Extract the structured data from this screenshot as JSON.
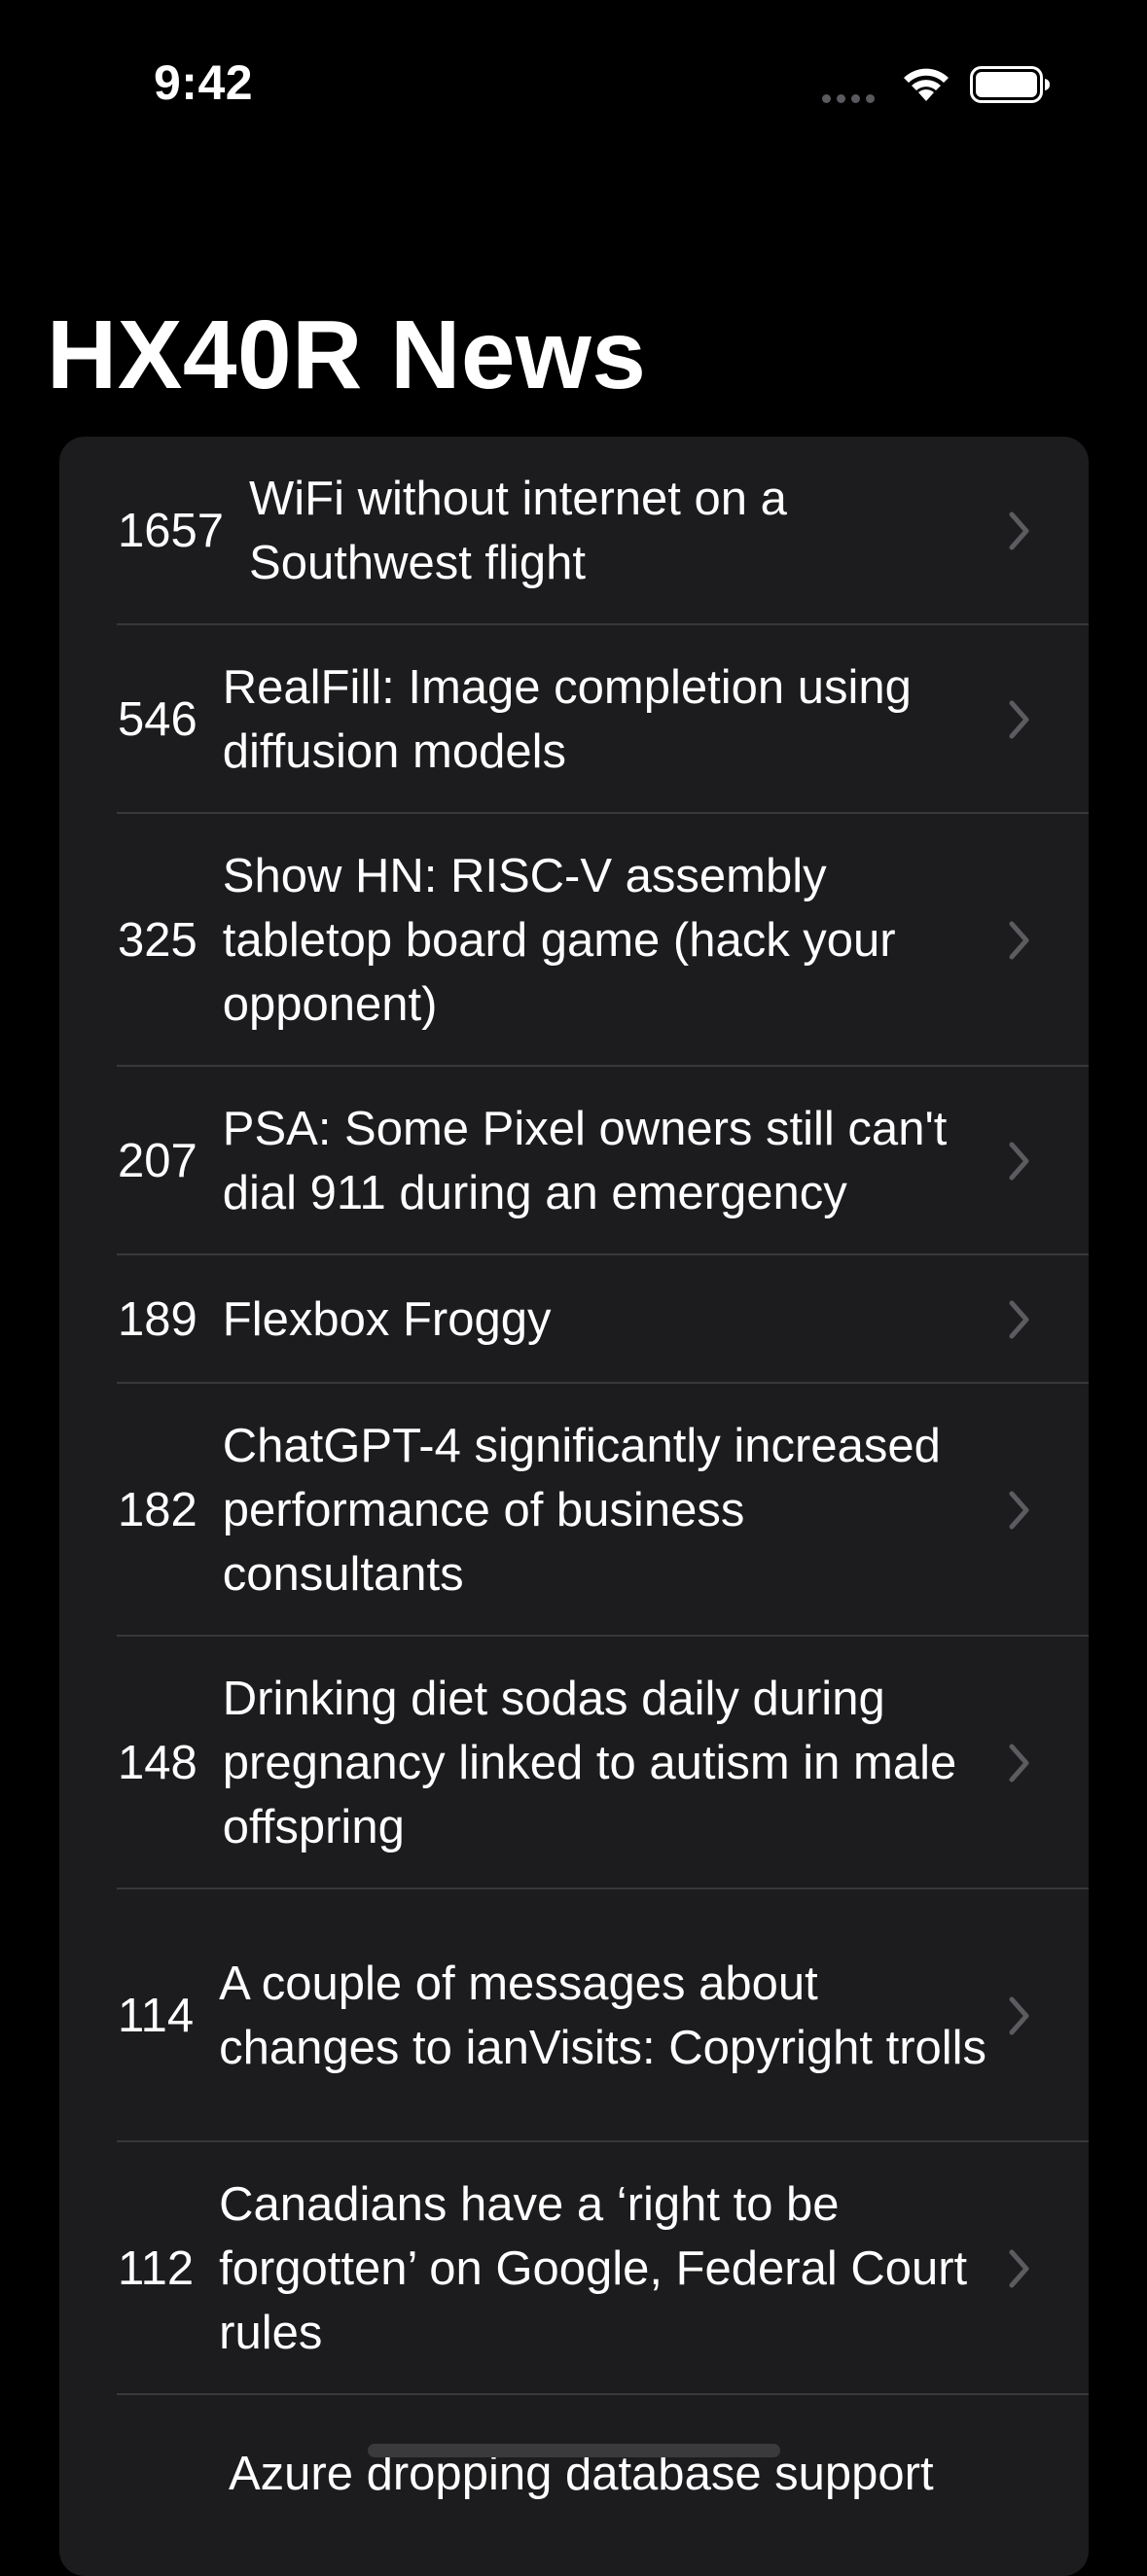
{
  "status_bar": {
    "time": "9:42",
    "wifi_icon": "wifi-icon",
    "battery_icon": "battery-icon"
  },
  "title": "HX40R News",
  "stories": [
    {
      "score": "1657",
      "title": "WiFi without internet on a Southwest flight"
    },
    {
      "score": "546",
      "title": "RealFill: Image completion using diffusion models"
    },
    {
      "score": "325",
      "title": "Show HN: RISC-V assembly tabletop board game (hack your opponent)"
    },
    {
      "score": "207",
      "title": "PSA: Some Pixel owners still can't dial 911 during an emergency"
    },
    {
      "score": "189",
      "title": "Flexbox Froggy"
    },
    {
      "score": "182",
      "title": "ChatGPT-4 significantly increased performance of business consultants"
    },
    {
      "score": "148",
      "title": "Drinking diet sodas daily during pregnancy linked to autism in male offspring"
    },
    {
      "score": "114",
      "title": "A couple of messages about changes to ianVisits: Copyright trolls"
    },
    {
      "score": "112",
      "title": "Canadians have a ‘right to be forgotten’ on Google, Federal Court rules"
    },
    {
      "score": "",
      "title": "Azure dropping database support"
    }
  ],
  "colors": {
    "background": "#000000",
    "card": "#1c1c1e",
    "separator": "#38383a",
    "chevron": "#5c5c60",
    "text": "#ffffff"
  }
}
